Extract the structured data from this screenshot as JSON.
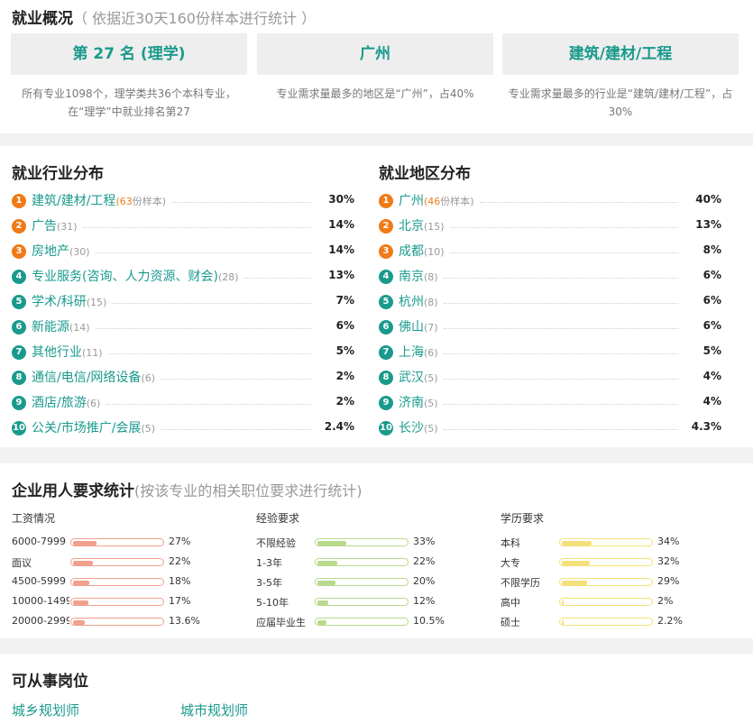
{
  "overview": {
    "title": "就业概况",
    "subtitle": "（ 依据近30天160份样本进行统计 ）",
    "boxes": [
      {
        "value": "第 27 名 (理学)",
        "desc": "所有专业1098个，理学类共36个本科专业，在“理学”中就业排名第27"
      },
      {
        "value": "广州",
        "desc": "专业需求量最多的地区是“广州”，占40%"
      },
      {
        "value": "建筑/建材/工程",
        "desc": "专业需求量最多的行业是“建筑/建材/工程”，占30%"
      }
    ]
  },
  "industry": {
    "title": "就业行业分布",
    "items": [
      {
        "rank": "1",
        "name": "建筑/建材/工程",
        "count": "63",
        "unit": "份样本",
        "pct": "30%"
      },
      {
        "rank": "2",
        "name": "广告",
        "count": "(31)",
        "pct": "14%"
      },
      {
        "rank": "3",
        "name": "房地产",
        "count": "(30)",
        "pct": "14%"
      },
      {
        "rank": "4",
        "name": "专业服务(咨询、人力资源、财会)",
        "count": "(28)",
        "pct": "13%"
      },
      {
        "rank": "5",
        "name": "学术/科研",
        "count": "(15)",
        "pct": "7%"
      },
      {
        "rank": "6",
        "name": "新能源",
        "count": "(14)",
        "pct": "6%"
      },
      {
        "rank": "7",
        "name": "其他行业",
        "count": "(11)",
        "pct": "5%"
      },
      {
        "rank": "8",
        "name": "通信/电信/网络设备",
        "count": "(6)",
        "pct": "2%"
      },
      {
        "rank": "9",
        "name": "酒店/旅游",
        "count": "(6)",
        "pct": "2%"
      },
      {
        "rank": "10",
        "name": "公关/市场推广/会展",
        "count": "(5)",
        "pct": "2.4%"
      }
    ]
  },
  "region": {
    "title": "就业地区分布",
    "items": [
      {
        "rank": "1",
        "name": "广州",
        "count": "46",
        "unit": "份样本",
        "pct": "40%"
      },
      {
        "rank": "2",
        "name": "北京",
        "count": "(15)",
        "pct": "13%"
      },
      {
        "rank": "3",
        "name": "成都",
        "count": "(10)",
        "pct": "8%"
      },
      {
        "rank": "4",
        "name": "南京",
        "count": "(8)",
        "pct": "6%"
      },
      {
        "rank": "5",
        "name": "杭州",
        "count": "(8)",
        "pct": "6%"
      },
      {
        "rank": "6",
        "name": "佛山",
        "count": "(7)",
        "pct": "6%"
      },
      {
        "rank": "7",
        "name": "上海",
        "count": "(6)",
        "pct": "5%"
      },
      {
        "rank": "8",
        "name": "武汉",
        "count": "(5)",
        "pct": "4%"
      },
      {
        "rank": "9",
        "name": "济南",
        "count": "(5)",
        "pct": "4%"
      },
      {
        "rank": "10",
        "name": "长沙",
        "count": "(5)",
        "pct": "4.3%"
      }
    ]
  },
  "requirements": {
    "title": "企业用人要求统计",
    "subtitle": "(按该专业的相关职位要求进行统计)",
    "groups": [
      {
        "title": "工资情况",
        "color": "#f0a08c",
        "rows": [
          {
            "label": "6000-7999",
            "value": "27%",
            "frac": 0.27
          },
          {
            "label": "面议",
            "value": "22%",
            "frac": 0.22
          },
          {
            "label": "4500-5999",
            "value": "18%",
            "frac": 0.18
          },
          {
            "label": "10000-14999",
            "value": "17%",
            "frac": 0.17
          },
          {
            "label": "20000-29999",
            "value": "13.6%",
            "frac": 0.136
          }
        ]
      },
      {
        "title": "经验要求",
        "color": "#b9d98c",
        "rows": [
          {
            "label": "不限经验",
            "value": "33%",
            "frac": 0.33
          },
          {
            "label": "1-3年",
            "value": "22%",
            "frac": 0.22
          },
          {
            "label": "3-5年",
            "value": "20%",
            "frac": 0.2
          },
          {
            "label": "5-10年",
            "value": "12%",
            "frac": 0.12
          },
          {
            "label": "应届毕业生",
            "value": "10.5%",
            "frac": 0.105
          }
        ]
      },
      {
        "title": "学历要求",
        "color": "#f5e07a",
        "rows": [
          {
            "label": "本科",
            "value": "34%",
            "frac": 0.34
          },
          {
            "label": "大专",
            "value": "32%",
            "frac": 0.32
          },
          {
            "label": "不限学历",
            "value": "29%",
            "frac": 0.29
          },
          {
            "label": "高中",
            "value": "2%",
            "frac": 0.02
          },
          {
            "label": "硕士",
            "value": "2.2%",
            "frac": 0.022
          }
        ]
      }
    ]
  },
  "jobs": {
    "title": "可从事岗位",
    "items": [
      "城乡规划师",
      "城市规划师"
    ]
  }
}
